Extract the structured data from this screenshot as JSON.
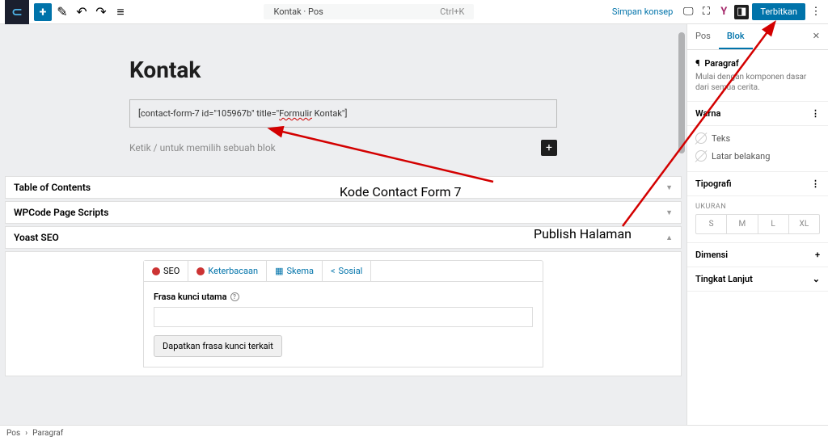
{
  "topbar": {
    "doc_title": "Kontak · Pos",
    "shortcut": "Ctrl+K",
    "save_draft": "Simpan konsep",
    "publish": "Terbitkan"
  },
  "editor": {
    "title": "Kontak",
    "shortcode_pre": "[contact-form-7 id=\"105967b\" title=\"",
    "shortcode_title": "Formulir",
    "shortcode_post": " Kontak\"]",
    "placeholder": "Ketik / untuk memilih sebuah blok"
  },
  "meta_panels": {
    "toc": "Table of Contents",
    "wpcode": "WPCode Page Scripts",
    "yoast": "Yoast SEO"
  },
  "yoast": {
    "tab_seo": "SEO",
    "tab_readability": "Keterbacaan",
    "tab_schema": "Skema",
    "tab_social": "Sosial",
    "focus_label": "Frasa kunci utama",
    "related_btn": "Dapatkan frasa kunci terkait"
  },
  "sidebar": {
    "tab_post": "Pos",
    "tab_block": "Blok",
    "block_name": "Paragraf",
    "block_desc": "Mulai dengan komponen dasar dari semua cerita.",
    "section_color": "Warna",
    "color_text": "Teks",
    "color_bg": "Latar belakang",
    "section_typo": "Tipografi",
    "size_label": "UKURAN",
    "sizes": [
      "S",
      "M",
      "L",
      "XL"
    ],
    "section_dim": "Dimensi",
    "section_adv": "Tingkat Lanjut"
  },
  "breadcrumb": {
    "root": "Pos",
    "current": "Paragraf"
  },
  "annotations": {
    "cf7": "Kode Contact Form 7",
    "publish": "Publish Halaman"
  }
}
